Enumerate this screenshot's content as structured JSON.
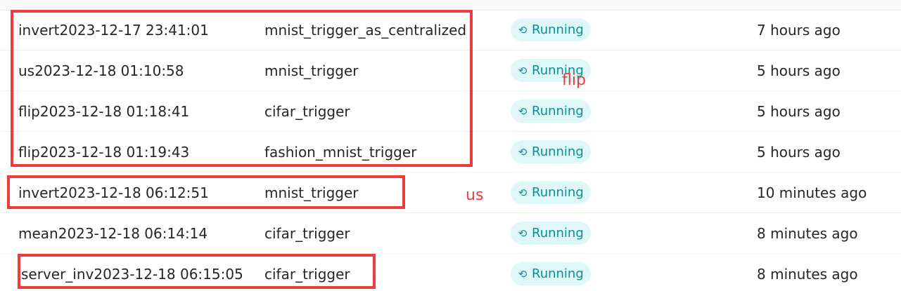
{
  "rows": [
    {
      "name": "invert2023-12-17 23:41:01",
      "trigger": "mnist_trigger_as_centralized",
      "status": "Running",
      "time": "7 hours ago"
    },
    {
      "name": "us2023-12-18 01:10:58",
      "trigger": "mnist_trigger",
      "status": "Running",
      "time": "5 hours ago"
    },
    {
      "name": "flip2023-12-18 01:18:41",
      "trigger": "cifar_trigger",
      "status": "Running",
      "time": "5 hours ago"
    },
    {
      "name": "flip2023-12-18 01:19:43",
      "trigger": "fashion_mnist_trigger",
      "status": "Running",
      "time": "5 hours ago"
    },
    {
      "name": "invert2023-12-18 06:12:51",
      "trigger": "mnist_trigger",
      "status": "Running",
      "time": "10 minutes ago"
    },
    {
      "name": "mean2023-12-18 06:14:14",
      "trigger": "cifar_trigger",
      "status": "Running",
      "time": "8 minutes ago"
    },
    {
      "name": "server_inv2023-12-18 06:15:05",
      "trigger": "cifar_trigger",
      "status": "Running",
      "time": "8 minutes ago"
    }
  ],
  "status_icon": "sync-icon",
  "annotations": {
    "flip_label": "flip",
    "us_label": "us"
  },
  "colors": {
    "annotation": "#ee3b3b",
    "status_bg": "#e0f7f7",
    "status_text": "#0a8f97"
  }
}
